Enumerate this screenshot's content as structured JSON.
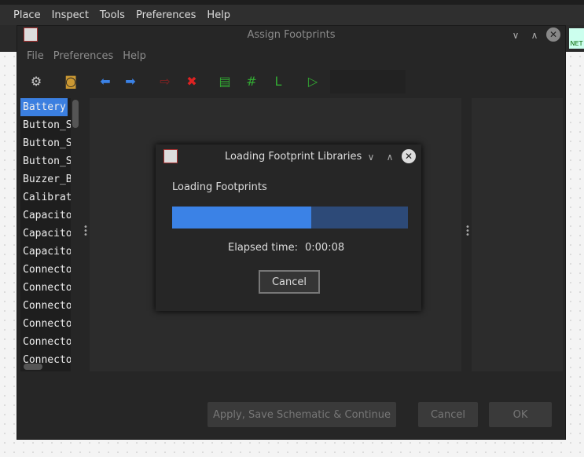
{
  "app_menu": [
    "Place",
    "Inspect",
    "Tools",
    "Preferences",
    "Help"
  ],
  "window": {
    "title": "Assign Footprints",
    "menu": [
      "File",
      "Preferences",
      "Help"
    ],
    "toolbar": [
      {
        "icon": "gear-icon"
      },
      {
        "icon": "library-browser-icon"
      },
      {
        "icon": "arrow-left-icon"
      },
      {
        "icon": "arrow-right-icon"
      },
      {
        "icon": "auto-associate-icon"
      },
      {
        "icon": "delete-associations-icon"
      },
      {
        "icon": "filter-description-icon"
      },
      {
        "icon": "filter-pin-count-icon"
      },
      {
        "icon": "filter-library-icon"
      },
      {
        "icon": "filter-text-icon"
      }
    ],
    "libraries": [
      "Battery",
      "Button_S",
      "Button_S",
      "Button_S",
      "Buzzer_B",
      "Calibrat",
      "Capacito",
      "Capacito",
      "Capacito",
      "Connecto",
      "Connecto",
      "Connecto",
      "Connecto",
      "Connecto",
      "Connecto"
    ],
    "buttons": {
      "apply": "Apply, Save Schematic & Continue",
      "cancel": "Cancel",
      "ok": "OK"
    }
  },
  "dialog": {
    "title": "Loading Footprint Libraries",
    "message": "Loading Footprints",
    "progress_percent": 59,
    "elapsed_label": "Elapsed time:",
    "elapsed": "0:00:08",
    "cancel": "Cancel"
  },
  "net_badge": "NET",
  "colors": {
    "accent": "#3b82e6",
    "progress_track": "#2d4a78"
  }
}
